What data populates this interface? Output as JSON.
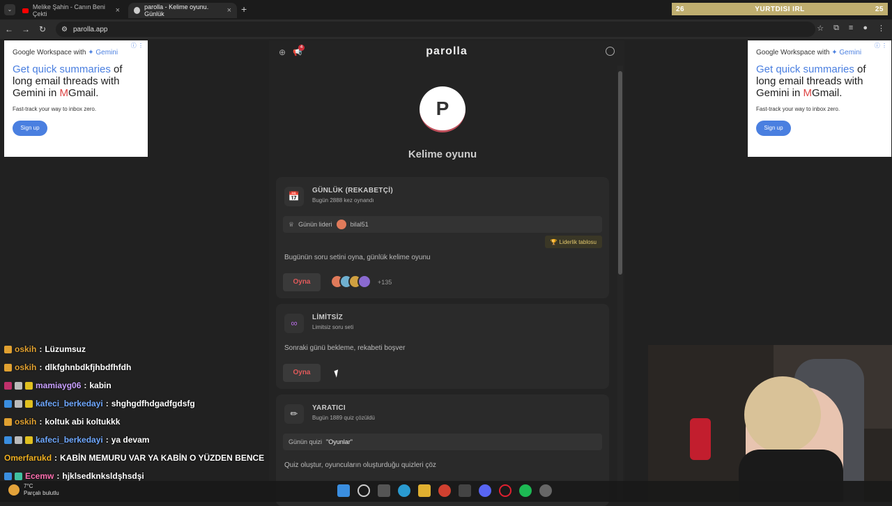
{
  "browser": {
    "tabs": [
      {
        "title": "Melike Şahin - Canın Beni Çekti"
      },
      {
        "title": "parolla - Kelime oyunu. Günlük"
      }
    ],
    "url": "parolla.app"
  },
  "overlay": {
    "left": "26",
    "center": "YURTDISI IRL",
    "right": "25"
  },
  "ads": {
    "brand": "Google Workspace with",
    "brand_gemini": "✦ Gemini",
    "headline_blue": "Get quick summaries",
    "headline_rest": " of long email threads with Gemini in ",
    "headline_gmail": "Gmail.",
    "sub": "Fast-track your way to inbox zero.",
    "cta": "Sign up"
  },
  "app": {
    "logo": "parolla",
    "notif_count": "4",
    "avatar_letter": "P",
    "page_title": "Kelime oyunu",
    "daily": {
      "title": "GÜNLÜK (REKABETÇİ)",
      "subtitle": "Bugün 2888 kez oynandı",
      "leader_label": "Günün lideri",
      "leader_name": "bilal51",
      "leaderboard": "Liderlik tablosu",
      "description": "Bugünün soru setini oyna, günlük kelime oyunu",
      "play": "Oyna",
      "players_more": "+135"
    },
    "unlimited": {
      "title": "LİMİTSİZ",
      "subtitle": "Limitsiz soru seti",
      "description": "Sonraki günü bekleme, rekabeti boşver",
      "play": "Oyna"
    },
    "creator": {
      "title": "YARATICI",
      "subtitle": "Bugün 1889 quiz çözüldü",
      "quiz_label": "Günün quizi",
      "quiz_name": "\"Oyunlar\"",
      "description": "Quiz oluştur, oyuncuların oluşturduğu quizleri çöz"
    }
  },
  "chat": [
    {
      "user": "oskih",
      "color": "#e0a030",
      "msg": "Lüzumsuz",
      "badges": [
        "#e0a030"
      ]
    },
    {
      "user": "oskih",
      "color": "#e0a030",
      "msg": "dlkfghnbdkfjhbdfhfdh",
      "badges": [
        "#e0a030"
      ]
    },
    {
      "user": "mamiayg06",
      "color": "#c9a0ff",
      "msg": "kabin",
      "badges": [
        "#c0306a",
        "#bbbbbb",
        "#e0c020"
      ]
    },
    {
      "user": "kafeci_berkedayi",
      "color": "#6fa8ff",
      "msg": "shghgdfhdgadfgdsfg",
      "badges": [
        "#3a8ee0",
        "#bbbbbb",
        "#e0c020"
      ]
    },
    {
      "user": "oskih",
      "color": "#e0a030",
      "msg": "koltuk abi koltukkk",
      "badges": [
        "#e0a030"
      ]
    },
    {
      "user": "kafeci_berkedayi",
      "color": "#6fa8ff",
      "msg": "ya devam",
      "badges": [
        "#3a8ee0",
        "#bbbbbb",
        "#e0c020"
      ]
    },
    {
      "user": "Omerfarukd",
      "color": "#f0b020",
      "msg": "KABİN MEMURU VAR YA KABİN O YÜZDEN BENCE",
      "badges": []
    },
    {
      "user": "Ecemw",
      "color": "#ff6fb0",
      "msg": "hjklsedknksldşhsdşi",
      "badges": [
        "#3a8ee0",
        "#40c0a0"
      ]
    }
  ],
  "taskbar": {
    "temp": "7°C",
    "weather": "Parçalı bulutlu"
  }
}
